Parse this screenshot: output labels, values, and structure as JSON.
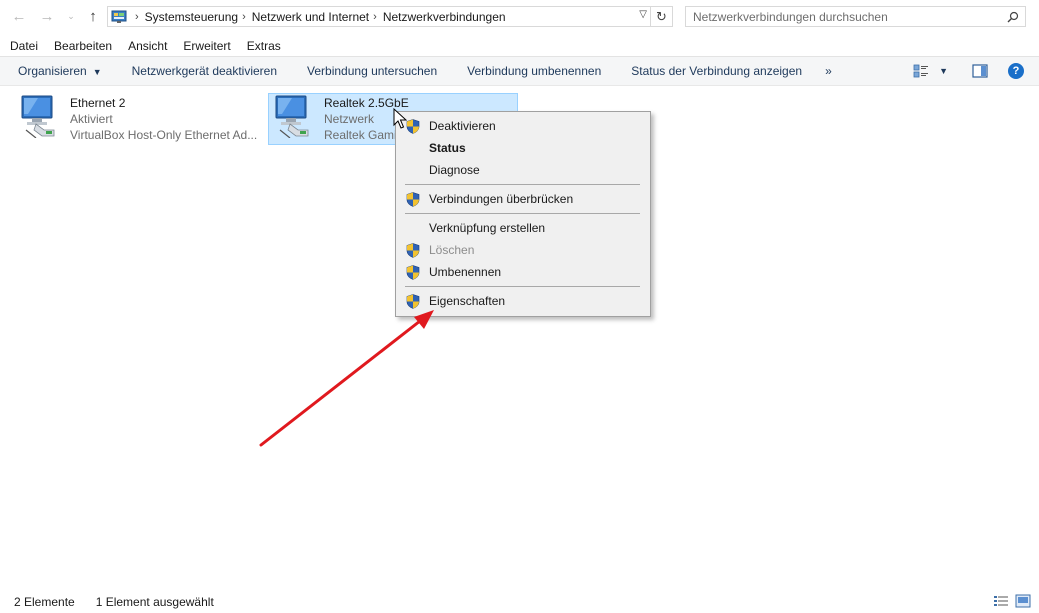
{
  "address": {
    "breadcrumbs": [
      "Systemsteuerung",
      "Netzwerk und Internet",
      "Netzwerkverbindungen"
    ],
    "search_placeholder": "Netzwerkverbindungen durchsuchen"
  },
  "menubar": [
    "Datei",
    "Bearbeiten",
    "Ansicht",
    "Erweitert",
    "Extras"
  ],
  "commands": {
    "organize": "Organisieren",
    "disable": "Netzwerkgerät deaktivieren",
    "diagnose": "Verbindung untersuchen",
    "rename": "Verbindung umbenennen",
    "status": "Status der Verbindung anzeigen",
    "more": "»"
  },
  "connections": [
    {
      "name": "Ethernet 2",
      "status": "Aktiviert",
      "device": "VirtualBox Host-Only Ethernet Ad..."
    },
    {
      "name": "Realtek 2.5GbE",
      "status": "Netzwerk",
      "device": "Realtek Gami"
    }
  ],
  "context_menu": {
    "deactivate": "Deaktivieren",
    "status": "Status",
    "diagnose": "Diagnose",
    "bridge": "Verbindungen überbrücken",
    "shortcut": "Verknüpfung erstellen",
    "delete": "Löschen",
    "rename": "Umbenennen",
    "properties": "Eigenschaften"
  },
  "statusbar": {
    "count": "2 Elemente",
    "selected": "1 Element ausgewählt"
  },
  "colors": {
    "selection": "#cce8ff",
    "arrow": "#e0191e",
    "link_text": "#1e395b"
  }
}
